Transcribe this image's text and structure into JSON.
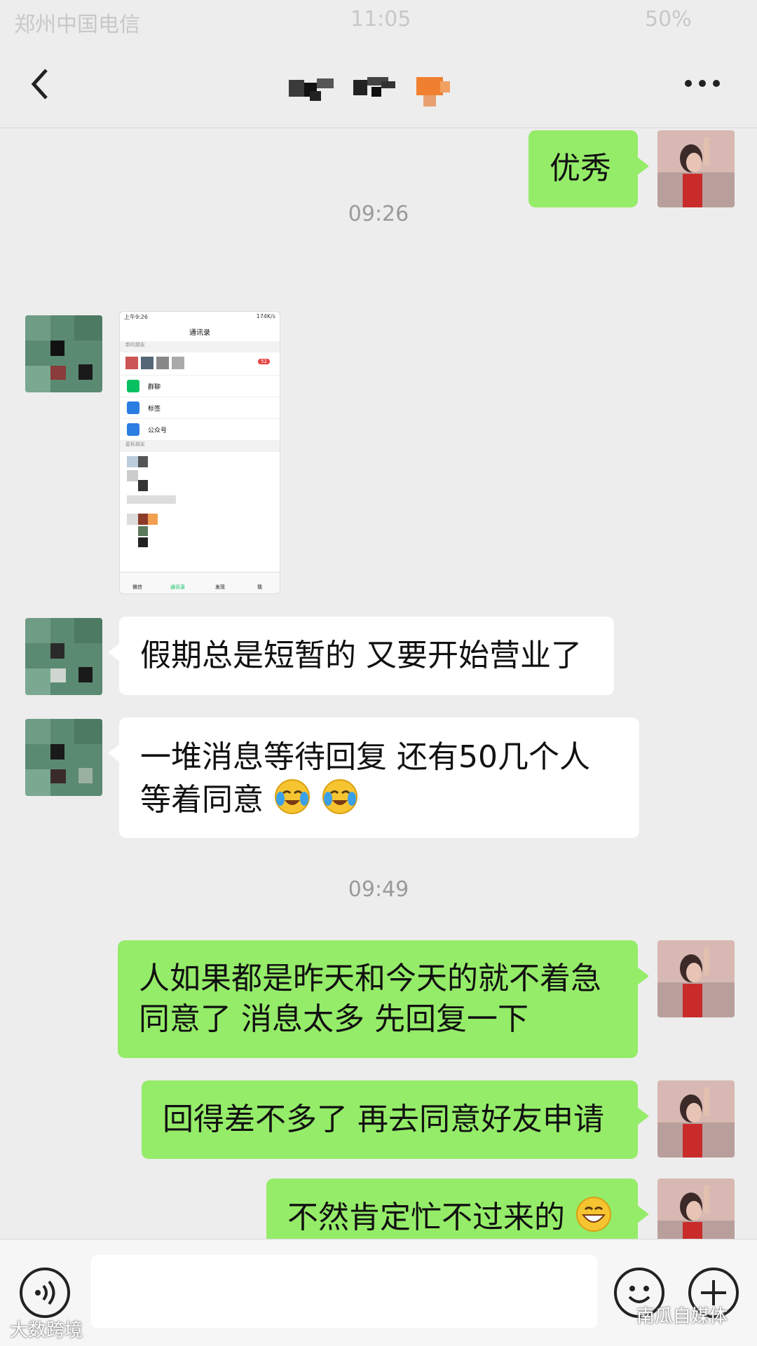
{
  "status_bar": {
    "carrier": "郑州中国电信",
    "time": "11:05",
    "battery": "50%"
  },
  "header": {
    "back_icon": "chevron-left-icon",
    "more_icon": "more-dots-icon"
  },
  "messages": [
    {
      "side": "right",
      "text": "优秀"
    },
    {
      "type": "timestamp",
      "text": "09:26"
    },
    {
      "side": "left",
      "type": "image"
    },
    {
      "side": "left",
      "text": "假期总是短暂的 又要开始营业了"
    },
    {
      "side": "left",
      "text_line1": "一堆消息等待回复 还有50几个人",
      "text_line2": "等着同意",
      "emoji": "crying-laughing-emoji"
    },
    {
      "type": "timestamp",
      "text": "09:49"
    },
    {
      "side": "right",
      "text_line1": "人如果都是昨天和今天的就不着急",
      "text_line2": "同意了 消息太多 先回复一下"
    },
    {
      "side": "right",
      "text": "回得差不多了 再去同意好友申请"
    },
    {
      "side": "right",
      "text": "不然肯定忙不过来的",
      "emoji": "grinning-emoji"
    }
  ],
  "shared_screenshot": {
    "status_time": "上午9:26",
    "status_net": "174K/s",
    "title": "通讯录",
    "section_new_friends": "新的朋友",
    "badge": "52",
    "items": [
      "群聊",
      "标签",
      "公众号"
    ],
    "section_starred": "星标朋友",
    "tabs": [
      "微信",
      "通讯录",
      "发现",
      "我"
    ]
  },
  "input_bar": {
    "voice_icon": "voice-icon",
    "emoji_icon": "smile-icon",
    "plus_icon": "plus-icon"
  },
  "watermarks": {
    "bottom_left": "大数跨境",
    "bottom_right": "南瓜自媒体"
  },
  "colors": {
    "sent_bubble": "#95ec69",
    "received_bubble": "#ffffff",
    "background": "#ededed"
  }
}
